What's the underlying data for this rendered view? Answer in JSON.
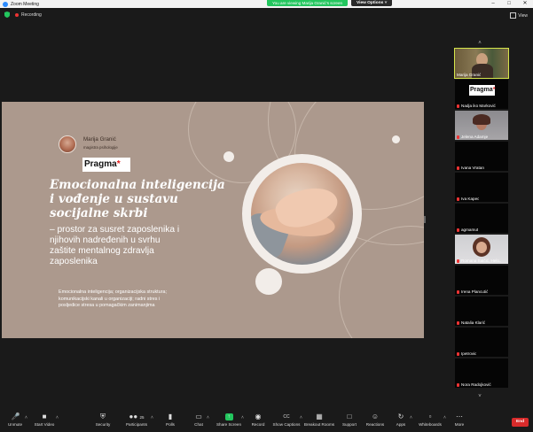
{
  "window": {
    "title": "Zoom Meeting"
  },
  "banner": {
    "viewing": "You are viewing Marija Granić's screen",
    "view_options": "View Options"
  },
  "recording": {
    "label": "Recording"
  },
  "view": {
    "label": "View"
  },
  "slide": {
    "presenter_name": "Marija Granić",
    "presenter_role": "magistra psihologije",
    "logo": "Pragma",
    "title_lines": [
      "Emocionalna inteligencija",
      "i vođenje u sustavu",
      "socijalne skrbi"
    ],
    "subtitle_lines": [
      "– prostor za susret zaposlenika i",
      "njihovih nadređenih u svrhu",
      "zaštite mentalnog zdravlja",
      "zaposlenika"
    ],
    "tags_lines": [
      "Emocionalna inteligencija; organizacijska struktura;",
      "komunikacijski kanali u organizaciji; radni stres i",
      "posljedice stresa u pomagačkim zanimanjima"
    ]
  },
  "participants": [
    {
      "name": "Marija Granić",
      "type": "video",
      "active": true
    },
    {
      "name": "Nadja iko Marković",
      "type": "logo",
      "logo": "Pragma"
    },
    {
      "name": "Jelena Adamje",
      "type": "video"
    },
    {
      "name": "Ivana Vratan",
      "type": "blank"
    },
    {
      "name": "Iva Kapec",
      "type": "blank"
    },
    {
      "name": "agmamut",
      "type": "blank"
    },
    {
      "name": "Romana Salčić, Helo..",
      "type": "video"
    },
    {
      "name": "Irena Plancutić",
      "type": "blank"
    },
    {
      "name": "Natalia Klarić",
      "type": "blank"
    },
    {
      "name": "Ipetrovic",
      "type": "blank"
    },
    {
      "name": "Nora Radojković",
      "type": "blank"
    }
  ],
  "toolbar": {
    "unmute": "Unmute",
    "start_video": "Start Video",
    "security": "Security",
    "participants": "Participants",
    "participants_count": "25",
    "polls": "Polls",
    "chat": "Chat",
    "share_screen": "Share Screen",
    "record": "Record",
    "show_captions": "Show Captions",
    "breakout_rooms": "Breakout Rooms",
    "support": "Support",
    "reactions": "Reactions",
    "apps": "Apps",
    "whiteboards": "Whiteboards",
    "more": "More",
    "end": "End"
  },
  "colors": {
    "slide_bg": "#ac998d",
    "share_green": "#23c65e",
    "end_red": "#d82b2b",
    "active_outline": "#d5e64b"
  }
}
